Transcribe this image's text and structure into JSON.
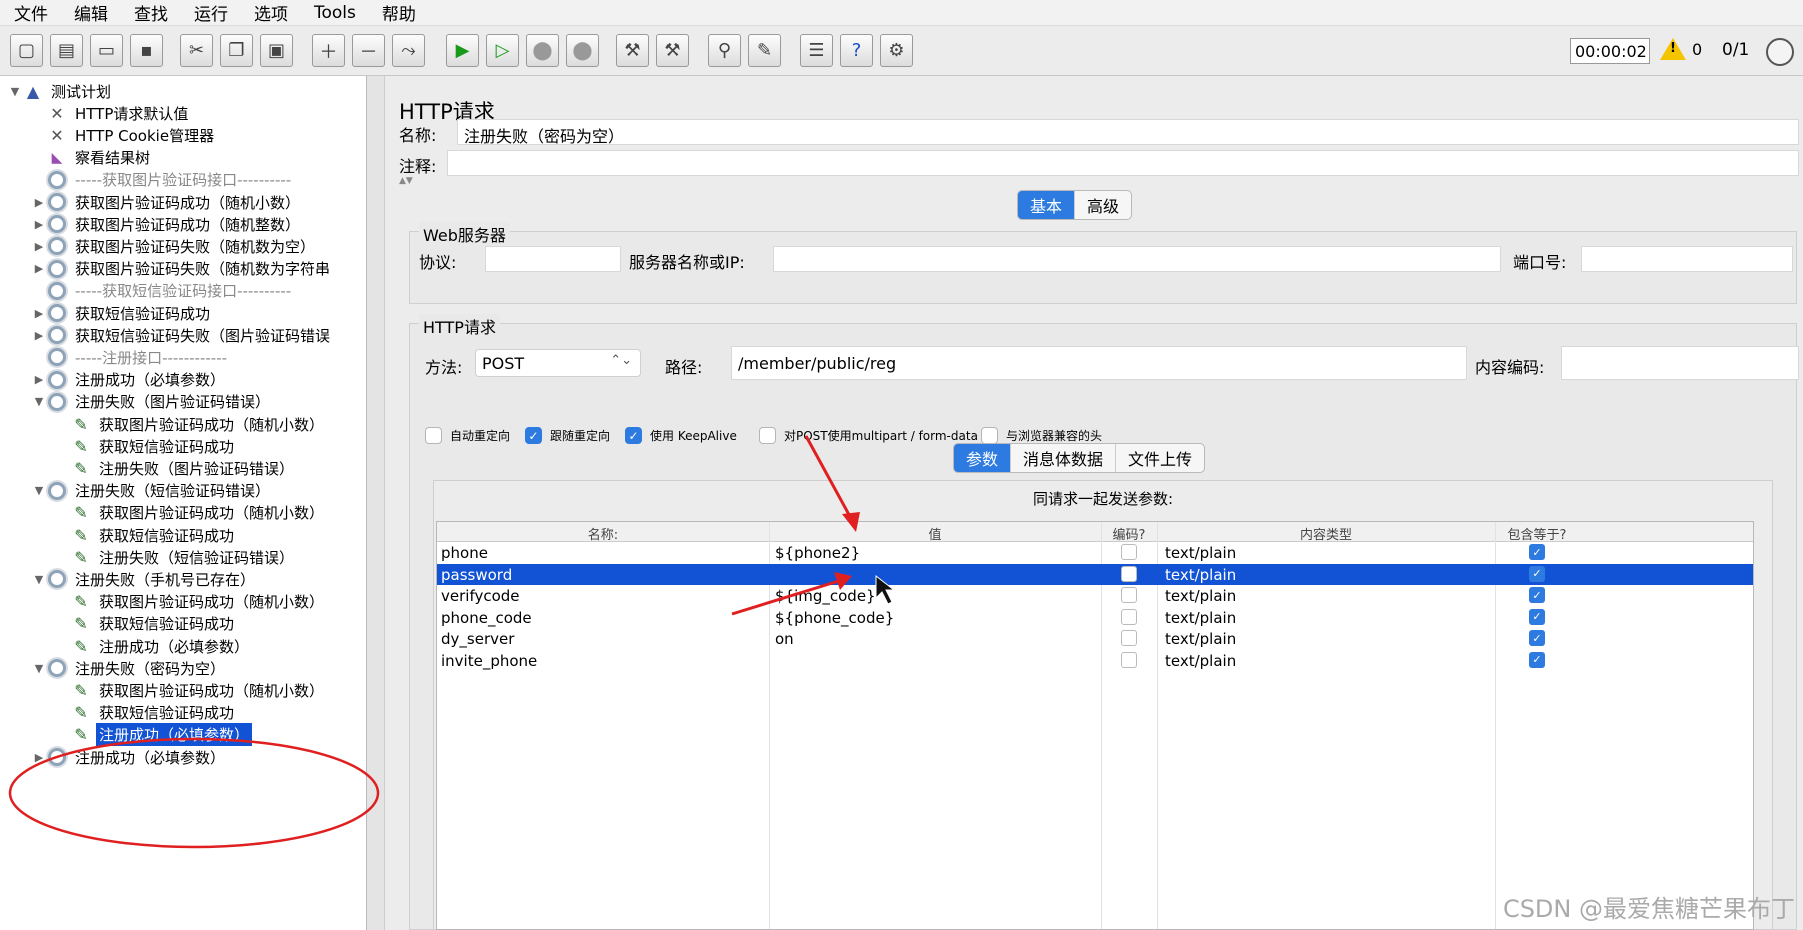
{
  "menu": [
    "文件",
    "编辑",
    "查找",
    "运行",
    "选项",
    "Tools",
    "帮助"
  ],
  "status": {
    "timer": "00:00:02",
    "warnings": "0",
    "threads": "0/1"
  },
  "tree": [
    {
      "indent": 0,
      "arrow": "▼",
      "icon": "flask",
      "label": "测试计划"
    },
    {
      "indent": 1,
      "arrow": "",
      "icon": "wrench",
      "label": "HTTP请求默认值"
    },
    {
      "indent": 1,
      "arrow": "",
      "icon": "wrench",
      "label": "HTTP Cookie管理器"
    },
    {
      "indent": 1,
      "arrow": "",
      "icon": "chart",
      "label": "察看结果树"
    },
    {
      "indent": 1,
      "arrow": "",
      "icon": "gear",
      "label": "-----获取图片验证码接口----------",
      "divider": true
    },
    {
      "indent": 1,
      "arrow": "▶",
      "icon": "gear",
      "label": "获取图片验证码成功（随机小数）"
    },
    {
      "indent": 1,
      "arrow": "▶",
      "icon": "gear",
      "label": "获取图片验证码成功（随机整数）"
    },
    {
      "indent": 1,
      "arrow": "▶",
      "icon": "gear",
      "label": "获取图片验证码失败（随机数为空）"
    },
    {
      "indent": 1,
      "arrow": "▶",
      "icon": "gear",
      "label": "获取图片验证码失败（随机数为字符串"
    },
    {
      "indent": 1,
      "arrow": "",
      "icon": "gear",
      "label": "-----获取短信验证码接口----------",
      "divider": true
    },
    {
      "indent": 1,
      "arrow": "▶",
      "icon": "gear",
      "label": "获取短信验证码成功"
    },
    {
      "indent": 1,
      "arrow": "▶",
      "icon": "gear",
      "label": "获取短信验证码失败（图片验证码错误"
    },
    {
      "indent": 1,
      "arrow": "",
      "icon": "gear",
      "label": "-----注册接口------------",
      "divider": true
    },
    {
      "indent": 1,
      "arrow": "▶",
      "icon": "gear",
      "label": "注册成功（必填参数）"
    },
    {
      "indent": 1,
      "arrow": "▼",
      "icon": "gear",
      "label": "注册失败（图片验证码错误）"
    },
    {
      "indent": 2,
      "arrow": "",
      "icon": "sampler",
      "label": "获取图片验证码成功（随机小数）"
    },
    {
      "indent": 2,
      "arrow": "",
      "icon": "sampler",
      "label": "获取短信验证码成功"
    },
    {
      "indent": 2,
      "arrow": "",
      "icon": "sampler",
      "label": "注册失败（图片验证码错误）"
    },
    {
      "indent": 1,
      "arrow": "▼",
      "icon": "gear",
      "label": "注册失败（短信验证码错误）"
    },
    {
      "indent": 2,
      "arrow": "",
      "icon": "sampler",
      "label": "获取图片验证码成功（随机小数）"
    },
    {
      "indent": 2,
      "arrow": "",
      "icon": "sampler",
      "label": "获取短信验证码成功"
    },
    {
      "indent": 2,
      "arrow": "",
      "icon": "sampler",
      "label": "注册失败（短信验证码错误）"
    },
    {
      "indent": 1,
      "arrow": "▼",
      "icon": "gear",
      "label": "注册失败（手机号已存在）"
    },
    {
      "indent": 2,
      "arrow": "",
      "icon": "sampler",
      "label": "获取图片验证码成功（随机小数）"
    },
    {
      "indent": 2,
      "arrow": "",
      "icon": "sampler",
      "label": "获取短信验证码成功"
    },
    {
      "indent": 2,
      "arrow": "",
      "icon": "sampler",
      "label": "注册成功（必填参数）"
    },
    {
      "indent": 1,
      "arrow": "▼",
      "icon": "gear",
      "label": "注册失败（密码为空）"
    },
    {
      "indent": 2,
      "arrow": "",
      "icon": "sampler",
      "label": "获取图片验证码成功（随机小数）"
    },
    {
      "indent": 2,
      "arrow": "",
      "icon": "sampler",
      "label": "获取短信验证码成功"
    },
    {
      "indent": 2,
      "arrow": "",
      "icon": "sampler",
      "label": "注册成功（必填参数）",
      "selected": true
    },
    {
      "indent": 1,
      "arrow": "▶",
      "icon": "gear",
      "label": "注册成功（必填参数）"
    }
  ],
  "panel": {
    "title": "HTTP请求",
    "name_label": "名称:",
    "name_value": "注册失败（密码为空）",
    "comment_label": "注释:",
    "tabs": [
      "基本",
      "高级"
    ],
    "web_server": {
      "legend": "Web服务器",
      "protocol_label": "协议:",
      "server_label": "服务器名称或IP:",
      "port_label": "端口号:"
    },
    "http_request": {
      "legend": "HTTP请求",
      "method_label": "方法:",
      "method_value": "POST",
      "path_label": "路径:",
      "path_value": "/member/public/reg",
      "encoding_label": "内容编码:",
      "checkboxes": [
        {
          "label": "自动重定向",
          "checked": false
        },
        {
          "label": "跟随重定向",
          "checked": true
        },
        {
          "label": "使用 KeepAlive",
          "checked": true
        },
        {
          "label": "对POST使用multipart / form-data",
          "checked": false
        },
        {
          "label": "与浏览器兼容的头",
          "checked": false
        }
      ],
      "subtabs": [
        "参数",
        "消息体数据",
        "文件上传"
      ],
      "params_title": "同请求一起发送参数:",
      "columns": [
        "名称:",
        "值",
        "编码?",
        "内容类型",
        "包含等于?"
      ],
      "rows": [
        {
          "name": "phone",
          "value": "${phone2}",
          "encode": false,
          "type": "text/plain",
          "include_eq": true,
          "selected": false
        },
        {
          "name": "password",
          "value": "",
          "encode": false,
          "type": "text/plain",
          "include_eq": true,
          "selected": true
        },
        {
          "name": "verifycode",
          "value": "${img_code}",
          "encode": false,
          "type": "text/plain",
          "include_eq": true,
          "selected": false
        },
        {
          "name": "phone_code",
          "value": "${phone_code}",
          "encode": false,
          "type": "text/plain",
          "include_eq": true,
          "selected": false
        },
        {
          "name": "dy_server",
          "value": "on",
          "encode": false,
          "type": "text/plain",
          "include_eq": true,
          "selected": false
        },
        {
          "name": "invite_phone",
          "value": "",
          "encode": false,
          "type": "text/plain",
          "include_eq": true,
          "selected": false
        }
      ]
    }
  },
  "watermark": "CSDN @最爱焦糖芒果布丁"
}
